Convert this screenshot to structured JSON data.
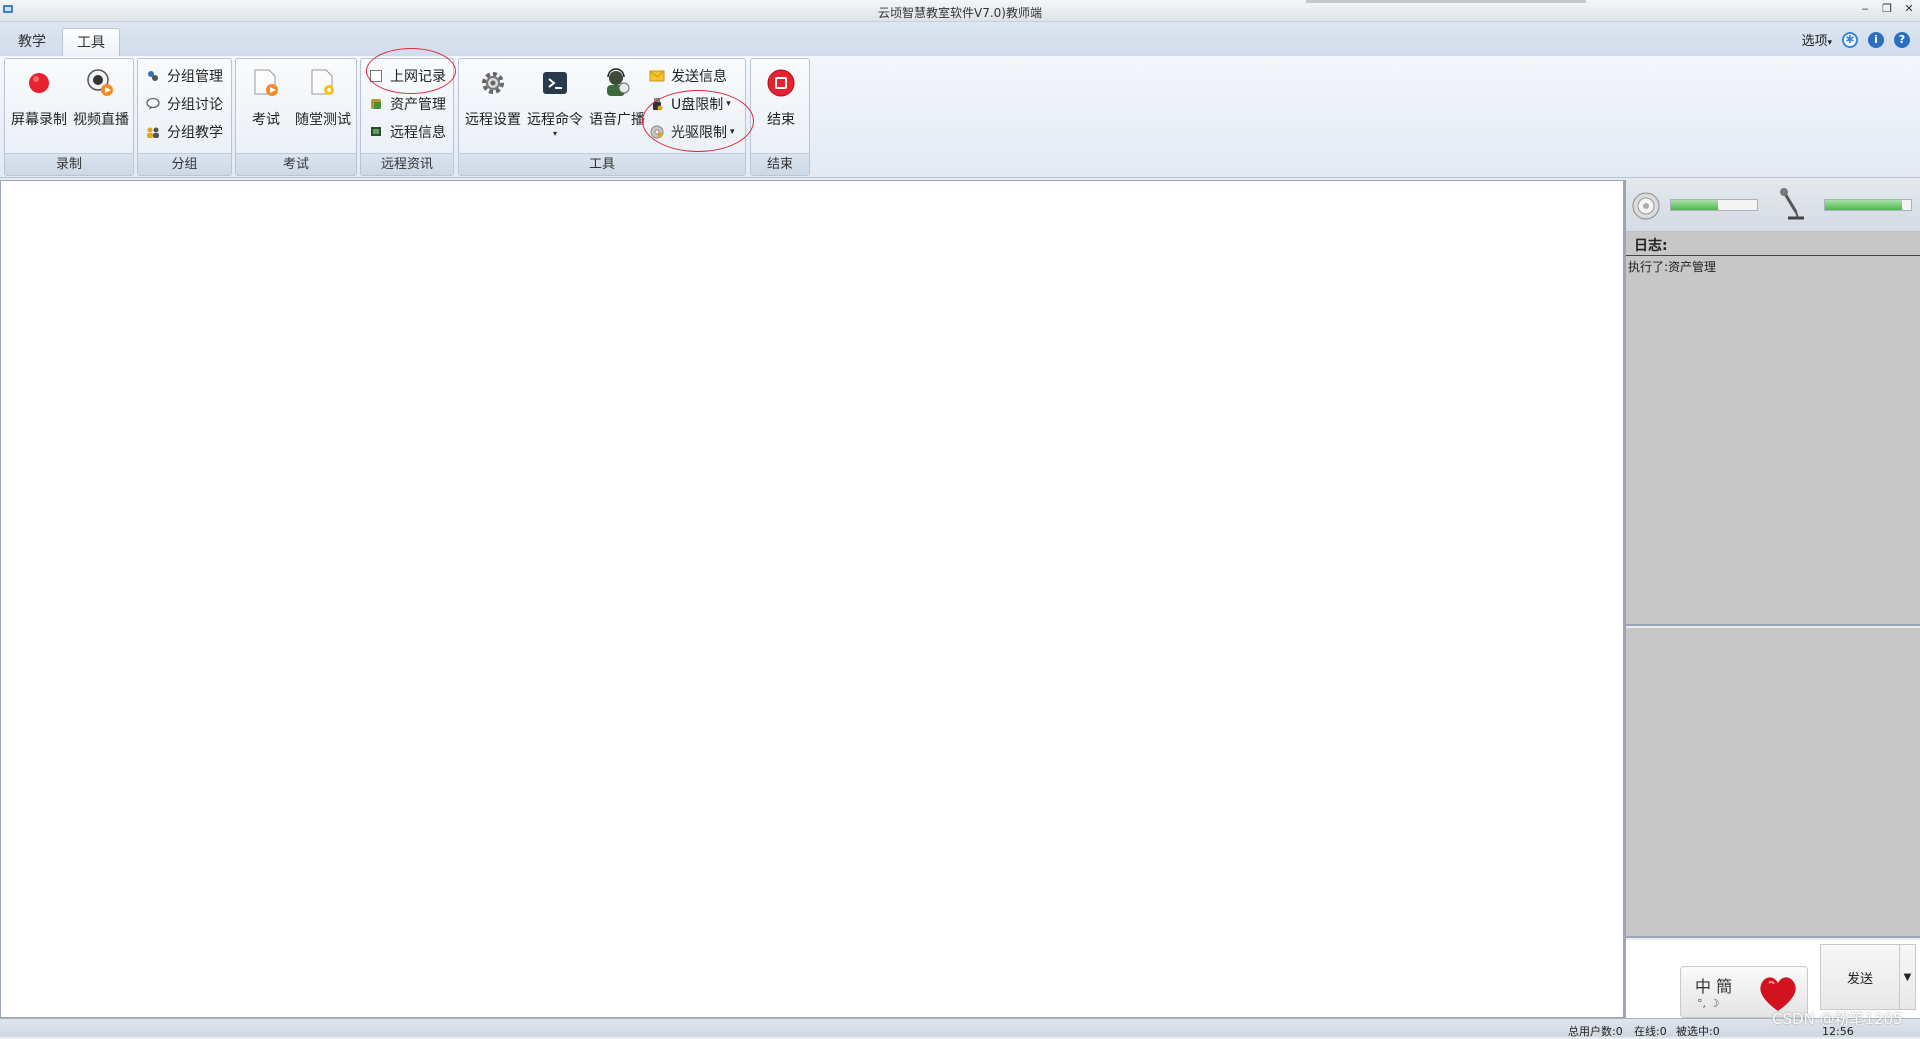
{
  "window": {
    "title": "云顷智慧教室软件V7.0)教师端",
    "controls": [
      "‒",
      "❐",
      "✕"
    ]
  },
  "tabs": [
    {
      "label": "教学",
      "active": false
    },
    {
      "label": "工具",
      "active": true
    }
  ],
  "options": {
    "label": "选项",
    "icons": [
      "settings-icon",
      "info-icon",
      "help-icon"
    ]
  },
  "ribbon": {
    "record": {
      "caption": "录制",
      "screen_record": "屏幕录制",
      "video_live": "视频直播"
    },
    "group": {
      "caption": "分组",
      "manage": "分组管理",
      "discuss": "分组讨论",
      "teach": "分组教学"
    },
    "exam": {
      "caption": "考试",
      "exam": "考试",
      "quiz": "随堂测试"
    },
    "remote_info": {
      "caption": "远程资讯",
      "web_record": "上网记录",
      "asset_manage": "资产管理",
      "remote_info": "远程信息"
    },
    "tools": {
      "caption": "工具",
      "remote_settings": "远程设置",
      "remote_command": "远程命令",
      "voice_broadcast": "语音广播",
      "send_message": "发送信息",
      "usb_limit": "U盘限制",
      "cdrom_limit": "光驱限制"
    },
    "end": {
      "caption": "结束",
      "end": "结束"
    }
  },
  "side_panel": {
    "log_title": "日志:",
    "log_entries": [
      "执行了:资产管理"
    ],
    "speaker_level": 0.55,
    "mic_level": 0.9,
    "ime_text": "中 簡",
    "ime_sub": "°, ☽",
    "send_label": "发送"
  },
  "status": {
    "total_users": "总用户数:0",
    "online": "在线:0",
    "selected": "被选中:0",
    "time": "12:56"
  },
  "watermark": "CSDN @粉笔1205",
  "colors": {
    "annotation_circle": "#e0283a",
    "record_red": "#e8212e",
    "meter_green": "#52b452"
  }
}
